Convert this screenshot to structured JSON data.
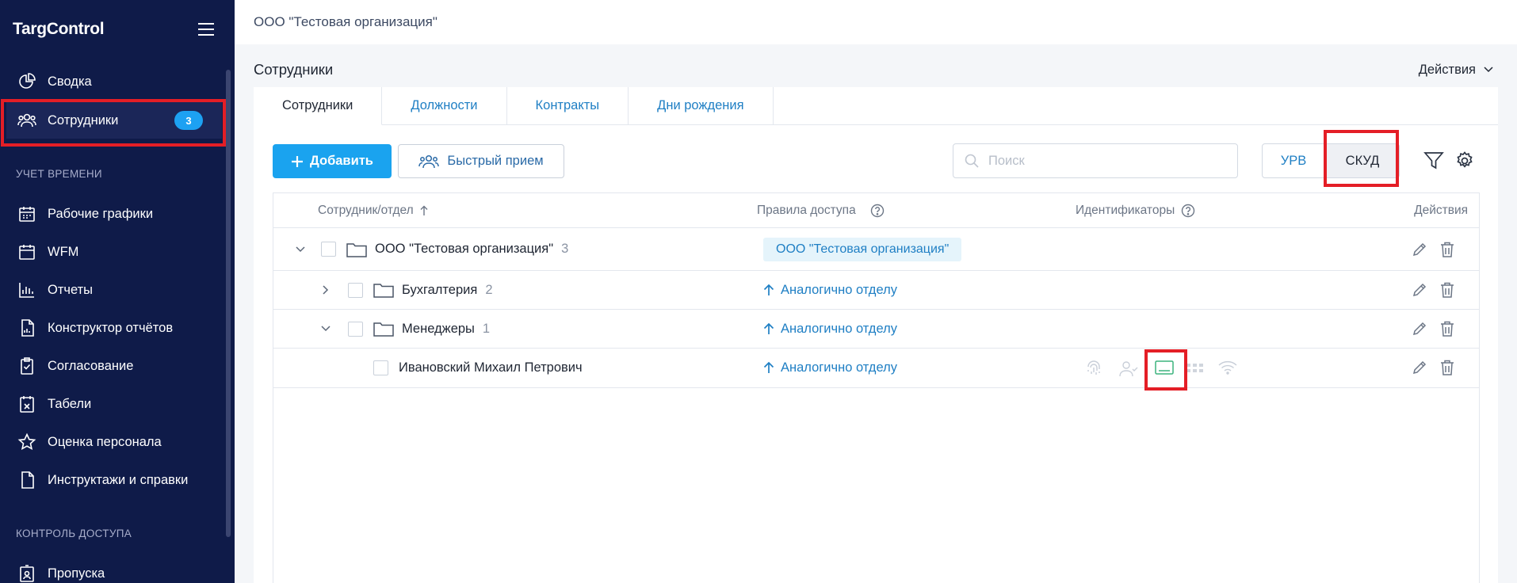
{
  "sidebar": {
    "logo": "TargControl",
    "items": [
      {
        "label": "Сводка",
        "icon": "pie-chart-icon"
      },
      {
        "label": "Сотрудники",
        "icon": "users-icon",
        "badge": "3",
        "active": true
      }
    ],
    "sections": [
      {
        "title": "УЧЕТ ВРЕМЕНИ",
        "items": [
          {
            "label": "Рабочие графики",
            "icon": "calendar-icon"
          },
          {
            "label": "WFM",
            "icon": "calendar-grid-icon"
          },
          {
            "label": "Отчеты",
            "icon": "bar-chart-icon"
          },
          {
            "label": "Конструктор отчётов",
            "icon": "report-doc-icon"
          },
          {
            "label": "Согласование",
            "icon": "clipboard-check-icon"
          },
          {
            "label": "Табели",
            "icon": "timesheet-icon"
          },
          {
            "label": "Оценка персонала",
            "icon": "star-icon"
          },
          {
            "label": "Инструктажи и справки",
            "icon": "document-icon"
          }
        ]
      },
      {
        "title": "КОНТРОЛЬ ДОСТУПА",
        "items": [
          {
            "label": "Пропуска",
            "icon": "badge-card-icon"
          }
        ]
      }
    ]
  },
  "topbar": {
    "organization": "ООО \"Тестовая организация\""
  },
  "page": {
    "title": "Сотрудники",
    "actions_label": "Действия"
  },
  "tabs": [
    {
      "label": "Сотрудники",
      "active": true
    },
    {
      "label": "Должности"
    },
    {
      "label": "Контракты"
    },
    {
      "label": "Дни рождения"
    }
  ],
  "toolbar": {
    "add_label": "Добавить",
    "quick_label": "Быстрый прием",
    "search_placeholder": "Поиск",
    "mode_urv": "УРВ",
    "mode_skud": "СКУД",
    "active_mode": "СКУД"
  },
  "table": {
    "columns": {
      "employee": "Сотрудник/отдел",
      "rules": "Правила доступа",
      "identifiers": "Идентификаторы",
      "actions": "Действия"
    },
    "rows": [
      {
        "type": "org",
        "name": "ООО \"Тестовая организация\"",
        "count": "3",
        "expanded": true,
        "rule": "ООО \"Тестовая организация\""
      },
      {
        "type": "department",
        "name": "Бухгалтерия",
        "count": "2",
        "expanded": false,
        "rule": "Аналогично отделу"
      },
      {
        "type": "department",
        "name": "Менеджеры",
        "count": "1",
        "expanded": true,
        "rule": "Аналогично отделу"
      },
      {
        "type": "employee",
        "name": "Ивановский Михаил Петрович",
        "rule": "Аналогично отделу",
        "identifiers": [
          "fingerprint-icon",
          "face-icon",
          "card-icon",
          "pin-code-icon",
          "wireless-icon"
        ],
        "active_identifier": "card-icon"
      }
    ]
  },
  "colors": {
    "sidebar_bg": "#0f1b49",
    "accent": "#1aa3ef",
    "link": "#1f7fc4",
    "highlight": "#e41e26",
    "identifier_active": "#3bb37d"
  }
}
